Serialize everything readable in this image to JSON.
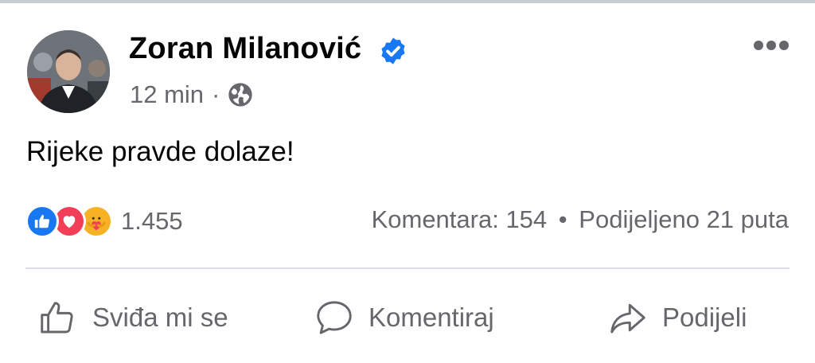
{
  "post": {
    "author_name": "Zoran Milanović",
    "verified": true,
    "time": "12 min",
    "separator": "·",
    "audience_icon": "globe-icon",
    "text": "Rijeke pravde dolaze!",
    "reactions": {
      "types": [
        "like-icon",
        "love-icon",
        "care-icon"
      ],
      "count": "1.455"
    },
    "comments": "Komentara: 154",
    "stats_separator": "•",
    "shares": "Podijeljeno 21 puta"
  },
  "actions": {
    "like_label": "Sviđa mi se",
    "comment_label": "Komentiraj",
    "share_label": "Podijeli"
  },
  "colors": {
    "text": "#050505",
    "muted": "#65676b",
    "brand_blue": "#1877f2",
    "love_red": "#f33e58",
    "care_yellow": "#f7b125",
    "divider": "#dadde1"
  }
}
